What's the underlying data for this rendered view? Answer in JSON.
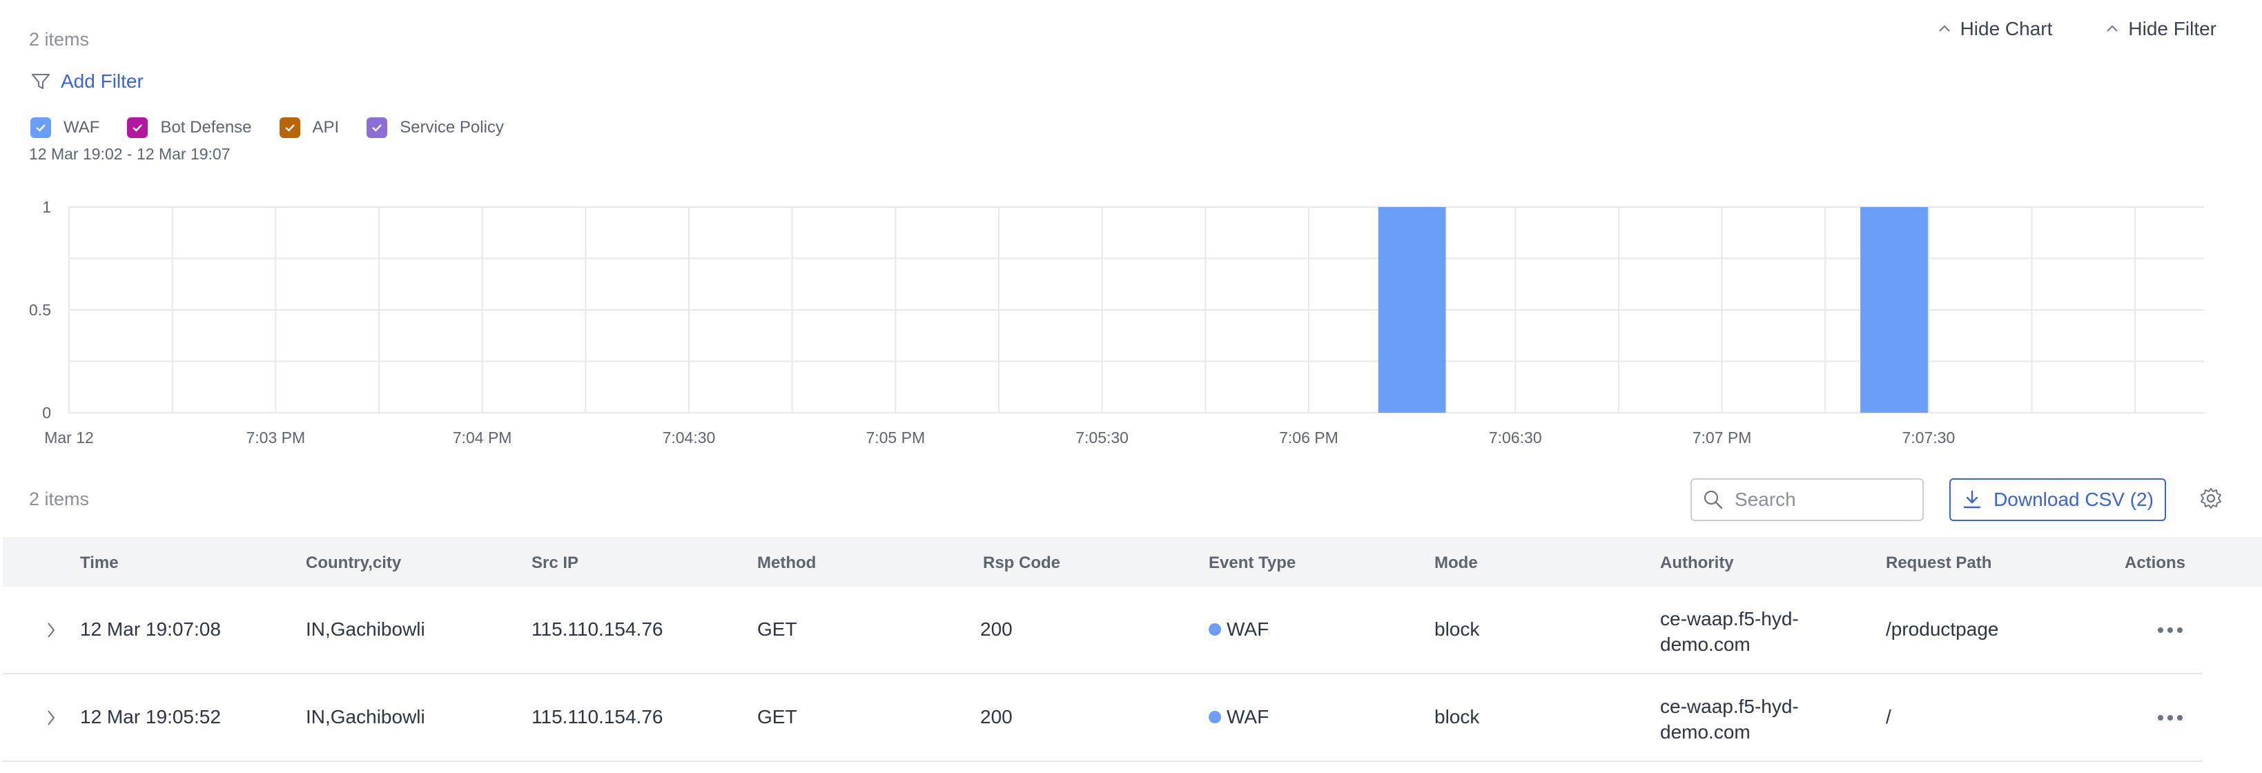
{
  "header": {
    "items_count": "2 items",
    "hide_chart_label": "Hide Chart",
    "hide_filter_label": "Hide Filter",
    "add_filter_label": "Add Filter"
  },
  "legend": [
    {
      "label": "WAF",
      "color": "#6b9ef7"
    },
    {
      "label": "Bot Defense",
      "color": "#b5179e"
    },
    {
      "label": "API",
      "color": "#b8650a"
    },
    {
      "label": "Service Policy",
      "color": "#8b6fd6"
    }
  ],
  "time_range": "12 Mar 19:02 - 12 Mar 19:07",
  "chart_data": {
    "type": "bar",
    "y_ticks": [
      "1",
      "0.5",
      "0"
    ],
    "ylim": [
      0,
      1
    ],
    "x_ticks": [
      "Mar 12",
      "7:03 PM",
      "7:04 PM",
      "7:04:30",
      "7:05 PM",
      "7:05:30",
      "7:06 PM",
      "7:06:30",
      "7:07 PM",
      "7:07:30"
    ],
    "bar_color": "#6b9ef7",
    "series": [
      {
        "name": "WAF",
        "points": [
          {
            "x": "7:05:52",
            "value": 1
          },
          {
            "x": "7:07:08",
            "value": 1
          }
        ]
      }
    ]
  },
  "toolbar": {
    "items_count": "2 items",
    "search_placeholder": "Search",
    "download_label": "Download CSV (2)"
  },
  "table": {
    "columns": [
      "Time",
      "Country,city",
      "Src IP",
      "Method",
      "Rsp Code",
      "Event Type",
      "Mode",
      "Authority",
      "Request Path",
      "Actions"
    ],
    "rows": [
      {
        "time": "12 Mar 19:07:08",
        "country_city": "IN,Gachibowli",
        "src_ip": "115.110.154.76",
        "method": "GET",
        "rsp_code": "200",
        "event_type": "WAF",
        "mode": "block",
        "authority_line1": "ce-waap.f5-hyd-",
        "authority_line2": "demo.com",
        "request_path": "/productpage"
      },
      {
        "time": "12 Mar 19:05:52",
        "country_city": "IN,Gachibowli",
        "src_ip": "115.110.154.76",
        "method": "GET",
        "rsp_code": "200",
        "event_type": "WAF",
        "mode": "block",
        "authority_line1": "ce-waap.f5-hyd-",
        "authority_line2": "demo.com",
        "request_path": "/"
      }
    ]
  }
}
